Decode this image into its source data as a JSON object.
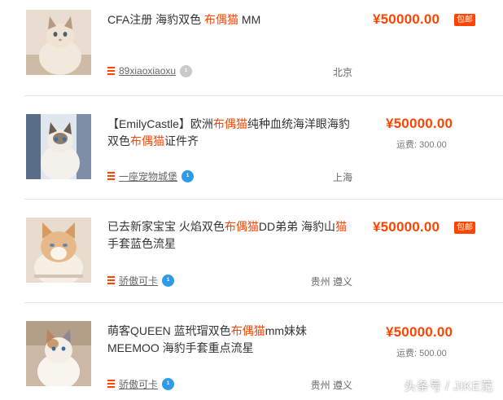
{
  "listings": [
    {
      "title_parts": [
        {
          "text": "CFA注册 海豹双色 ",
          "hl": false
        },
        {
          "text": "布偶猫",
          "hl": true
        },
        {
          "text": " MM",
          "hl": false
        }
      ],
      "price": "¥50000.00",
      "badge": "包邮",
      "shipping": "",
      "seller": "89xiaoxiaoxu",
      "seller_level_color": "grey",
      "location": "北京",
      "thumb_icon": "cat-photo-icon"
    },
    {
      "title_parts": [
        {
          "text": "【EmilyCastle】欧洲",
          "hl": false
        },
        {
          "text": "布偶猫",
          "hl": true
        },
        {
          "text": "纯种血统海洋眼海豹双色",
          "hl": false
        },
        {
          "text": "布偶猫",
          "hl": true
        },
        {
          "text": "证件齐",
          "hl": false
        }
      ],
      "price": "¥50000.00",
      "badge": "",
      "shipping": "运费: 300.00",
      "seller": "一座宠物城堡",
      "seller_level_color": "blue",
      "location": "上海",
      "thumb_icon": "cat-photo-icon"
    },
    {
      "title_parts": [
        {
          "text": "已去新家宝宝 火焰双色",
          "hl": false
        },
        {
          "text": "布偶猫",
          "hl": true
        },
        {
          "text": "DD弟弟 海豹山",
          "hl": false
        },
        {
          "text": "猫",
          "hl": true
        },
        {
          "text": "手套蓝色流星",
          "hl": false
        }
      ],
      "price": "¥50000.00",
      "badge": "包邮",
      "shipping": "",
      "seller": "骄傲可卡",
      "seller_level_color": "blue",
      "location": "贵州 遵义",
      "thumb_icon": "cat-photo-icon"
    },
    {
      "title_parts": [
        {
          "text": "萌客QUEEN 蓝玳瑁双色",
          "hl": false
        },
        {
          "text": "布偶猫",
          "hl": true
        },
        {
          "text": "mm妹妹 MEEMOO 海豹手套重点流星",
          "hl": false
        }
      ],
      "price": "¥50000.00",
      "badge": "",
      "shipping": "运费: 500.00",
      "seller": "骄傲可卡",
      "seller_level_color": "blue",
      "location": "贵州 遵义",
      "thumb_icon": "cat-photo-icon"
    }
  ],
  "watermark": "头条号 / JIKE范",
  "colors": {
    "accent": "#ff4400",
    "level_blue": "#2d9be8",
    "level_grey": "#c9c9c9"
  }
}
